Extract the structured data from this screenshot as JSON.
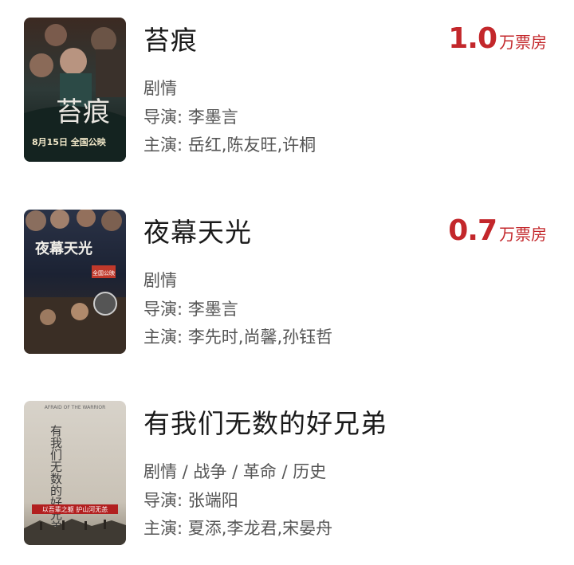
{
  "movies": [
    {
      "title": "苔痕",
      "genres": "剧情",
      "director_label": "导演: ",
      "director": "李墨言",
      "cast_label": "主演: ",
      "cast": "岳红,陈友旺,许桐",
      "box_office_value": "1.0",
      "box_office_unit": "万票房",
      "poster": {
        "title_text": "苔痕",
        "release_text": "8月15日 全国公映"
      }
    },
    {
      "title": "夜幕天光",
      "genres": "剧情",
      "director_label": "导演: ",
      "director": "李墨言",
      "cast_label": "主演: ",
      "cast": "李先时,尚馨,孙钰哲",
      "box_office_value": "0.7",
      "box_office_unit": "万票房",
      "poster": {
        "title_text": "夜幕天光",
        "release_text": "全国公映"
      }
    },
    {
      "title": "有我们无数的好兄弟",
      "genres": "剧情 / 战争 / 革命 / 历史",
      "director_label": "导演: ",
      "director": "张端阳",
      "cast_label": "主演: ",
      "cast": "夏添,李龙君,宋晏舟",
      "poster": {
        "title_text": "有我们无数的好兄弟",
        "top_text": "AFRAID OF THE WARRIOR",
        "tagline": "以吾辈之躯 护山河无恙"
      }
    }
  ],
  "colors": {
    "box_office": "#c3272b",
    "title": "#1a1a1a",
    "meta": "#555555"
  }
}
